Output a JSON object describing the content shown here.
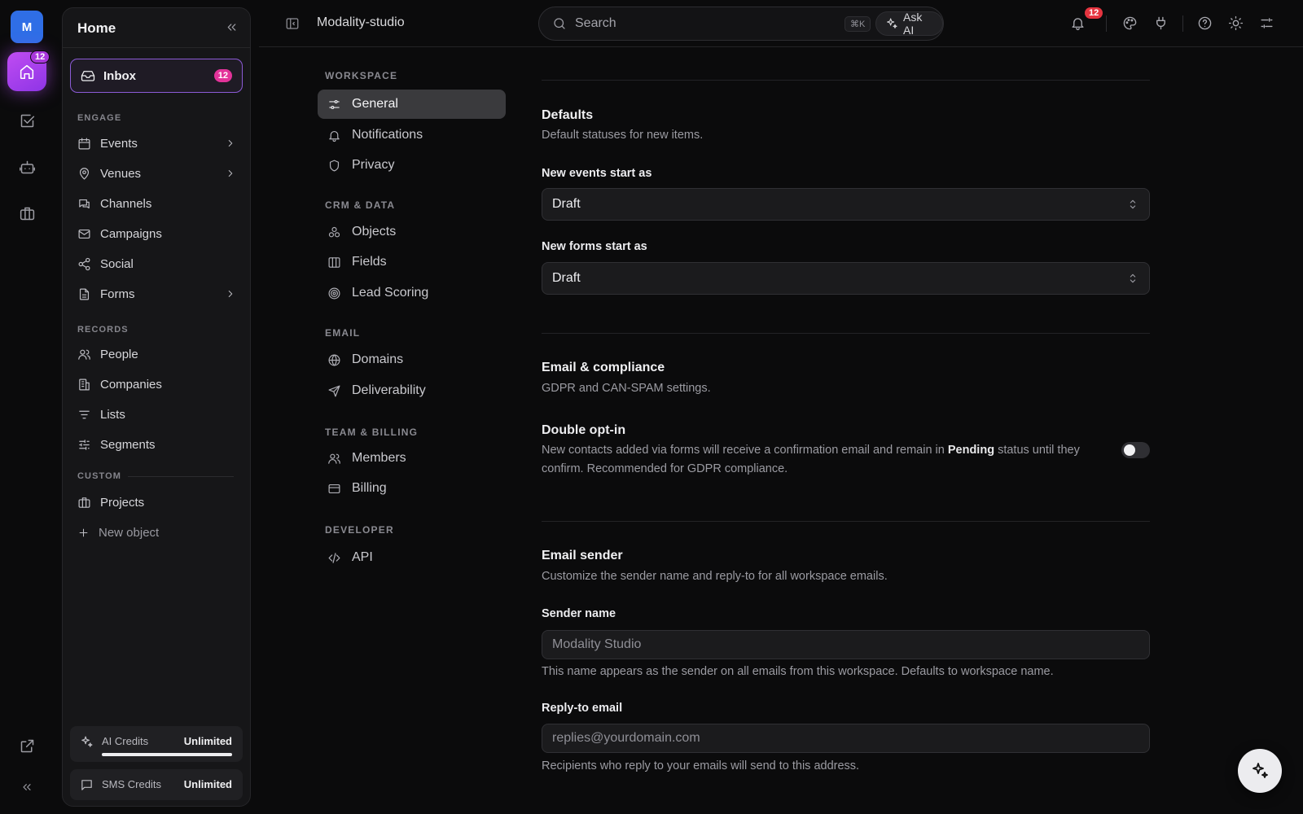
{
  "rail": {
    "avatar_letter": "M",
    "home_badge": "12"
  },
  "sidebar": {
    "title": "Home",
    "inbox": {
      "label": "Inbox",
      "badge": "12"
    },
    "sections": {
      "engage": "ENGAGE",
      "records": "RECORDS",
      "custom": "CUSTOM"
    },
    "engage_items": [
      {
        "label": "Events",
        "icon": "calendar-icon",
        "has_chevron": true
      },
      {
        "label": "Venues",
        "icon": "map-pin-icon",
        "has_chevron": true
      },
      {
        "label": "Channels",
        "icon": "chat-icon"
      },
      {
        "label": "Campaigns",
        "icon": "mail-icon"
      },
      {
        "label": "Social",
        "icon": "share-icon"
      },
      {
        "label": "Forms",
        "icon": "file-icon",
        "has_chevron": true
      }
    ],
    "records_items": [
      {
        "label": "People",
        "icon": "users-icon"
      },
      {
        "label": "Companies",
        "icon": "building-icon"
      },
      {
        "label": "Lists",
        "icon": "list-icon"
      },
      {
        "label": "Segments",
        "icon": "sliders-icon"
      }
    ],
    "custom_items": [
      {
        "label": "Projects",
        "icon": "briefcase-icon"
      },
      {
        "label": "New object",
        "icon": "plus-icon"
      }
    ],
    "credits": {
      "ai": {
        "label": "AI Credits",
        "value": "Unlimited",
        "fill": 1.0
      },
      "sms": {
        "label": "SMS Credits",
        "value": "Unlimited"
      }
    }
  },
  "topbar": {
    "workspace": "Modality-studio",
    "search_placeholder": "Search",
    "shortcut": "⌘K",
    "ask_ai": "Ask AI",
    "notification_count": "12"
  },
  "settings_nav": {
    "sections": [
      {
        "title": "WORKSPACE",
        "items": [
          {
            "label": "General",
            "icon": "sliders-icon",
            "active": true
          },
          {
            "label": "Notifications",
            "icon": "bell-icon"
          },
          {
            "label": "Privacy",
            "icon": "shield-icon"
          }
        ]
      },
      {
        "title": "CRM & DATA",
        "items": [
          {
            "label": "Objects",
            "icon": "objects-icon"
          },
          {
            "label": "Fields",
            "icon": "columns-icon"
          },
          {
            "label": "Lead Scoring",
            "icon": "target-icon"
          }
        ]
      },
      {
        "title": "EMAIL",
        "items": [
          {
            "label": "Domains",
            "icon": "globe-icon"
          },
          {
            "label": "Deliverability",
            "icon": "send-icon"
          }
        ]
      },
      {
        "title": "TEAM & BILLING",
        "items": [
          {
            "label": "Members",
            "icon": "users-icon"
          },
          {
            "label": "Billing",
            "icon": "card-icon"
          }
        ]
      },
      {
        "title": "DEVELOPER",
        "items": [
          {
            "label": "API",
            "icon": "code-icon"
          }
        ]
      }
    ]
  },
  "content": {
    "defaults": {
      "title": "Defaults",
      "subtitle": "Default statuses for new items.",
      "events_label": "New events start as",
      "events_value": "Draft",
      "forms_label": "New forms start as",
      "forms_value": "Draft"
    },
    "compliance": {
      "title": "Email & compliance",
      "subtitle": "GDPR and CAN-SPAM settings.",
      "optin_title": "Double opt-in",
      "optin_desc_1": "New contacts added via forms will receive a confirmation email and remain in",
      "optin_desc_bold": "Pending",
      "optin_desc_2": "status until they confirm. Recommended for GDPR compliance.",
      "optin_enabled": false
    },
    "sender": {
      "title": "Email sender",
      "subtitle": "Customize the sender name and reply-to for all workspace emails.",
      "name_label": "Sender name",
      "name_placeholder": "Modality Studio",
      "name_help": "This name appears as the sender on all emails from this workspace. Defaults to workspace name.",
      "reply_label": "Reply-to email",
      "reply_placeholder": "replies@yourdomain.com",
      "reply_help": "Recipients who reply to your emails will send to this address."
    }
  }
}
